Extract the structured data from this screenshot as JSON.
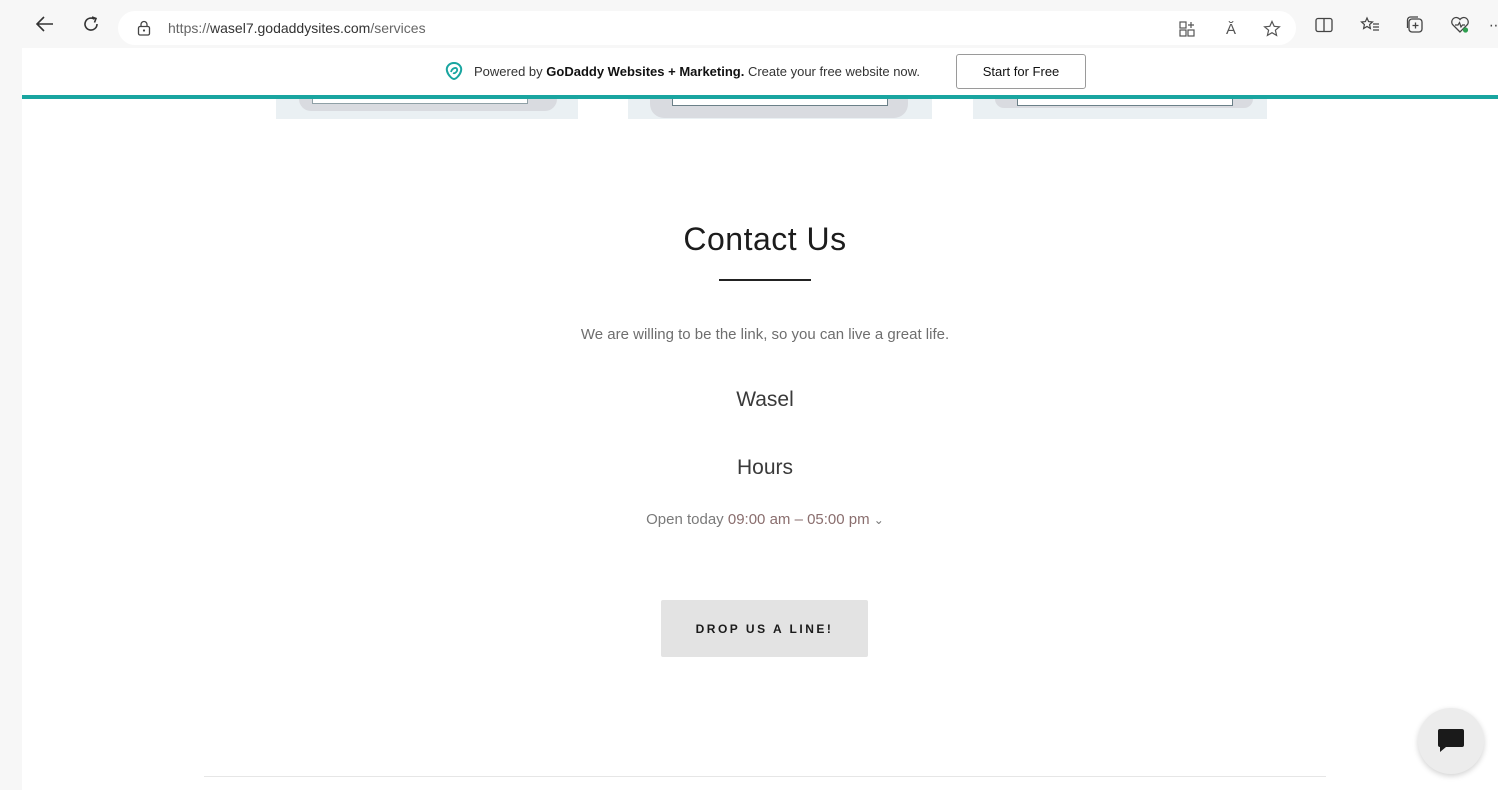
{
  "browser": {
    "url_prefix": "https://",
    "url_host": "wasel7.godaddysites.com",
    "url_path": "/services",
    "read_aloud_icon_text": "Ă"
  },
  "banner": {
    "powered_by": "Powered by",
    "brand": "GoDaddy Websites + Marketing.",
    "tail": "Create your free website now.",
    "cta_label": "Start for Free",
    "accent_color": "#19a5a0"
  },
  "contact": {
    "title": "Contact Us",
    "tagline": "We are willing to be the link, so you can live a great life.",
    "business_name": "Wasel",
    "hours_heading": "Hours",
    "hours_prefix": "Open today",
    "hours_range": "09:00 am – 05:00 pm",
    "cta_label": "DROP US A LINE!"
  }
}
